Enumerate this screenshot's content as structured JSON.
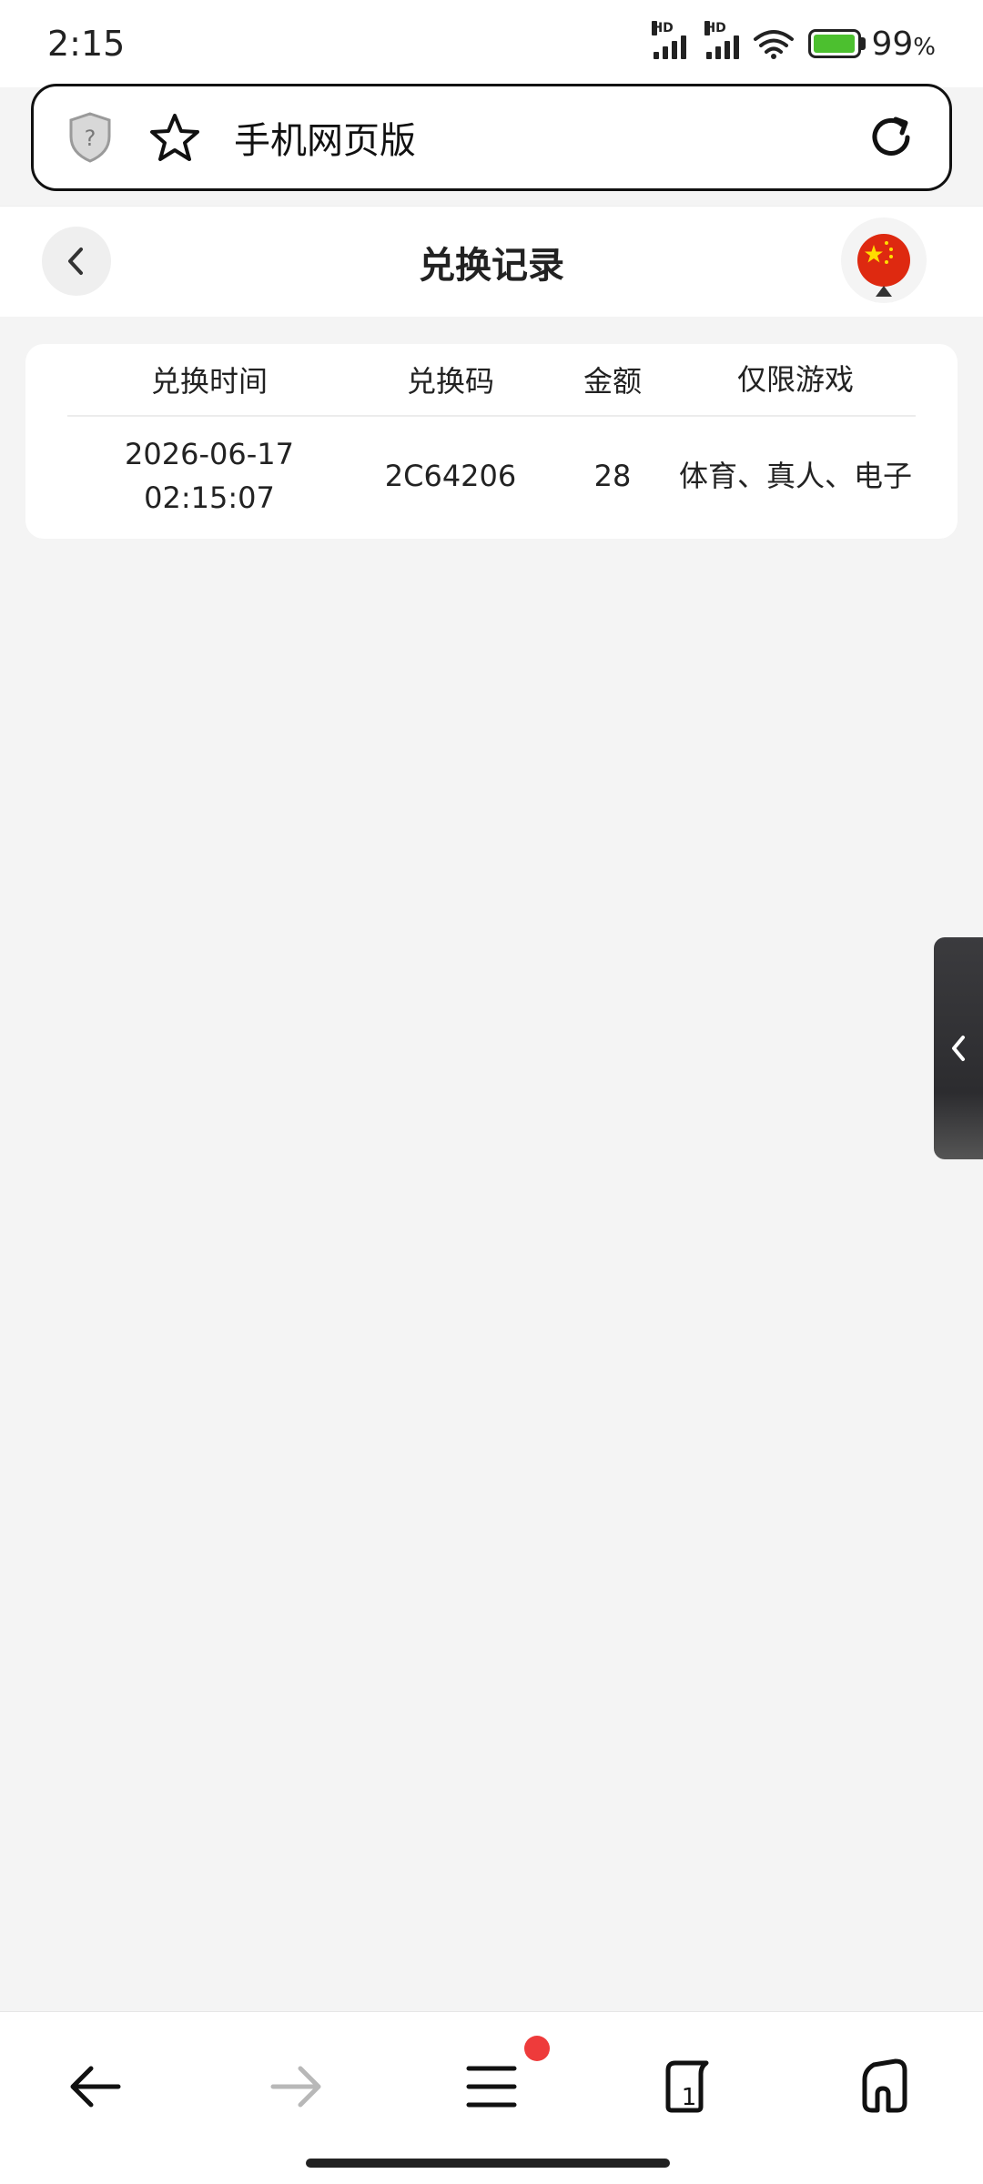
{
  "status_bar": {
    "time": "2:15",
    "battery_percent": "99",
    "battery_unit": "%",
    "signal_label_1": "HD",
    "signal_label_2": "HD"
  },
  "browser": {
    "url_title": "手机网页版"
  },
  "header": {
    "title": "兑换记录"
  },
  "table": {
    "headers": [
      "兑换时间",
      "兑换码",
      "金额",
      "仅限游戏"
    ],
    "rows": [
      {
        "time_date": "2026-06-17",
        "time_clock": "02:15:07",
        "code": "2C64206",
        "amount": "28",
        "games": "体育、真人、电子"
      }
    ]
  },
  "bottom_nav": {
    "tabs_count": "1"
  },
  "colors": {
    "accent_red": "#ee3b3b",
    "battery_green": "#4cc02f",
    "flag_red": "#de2910",
    "flag_yellow": "#ffde00"
  }
}
